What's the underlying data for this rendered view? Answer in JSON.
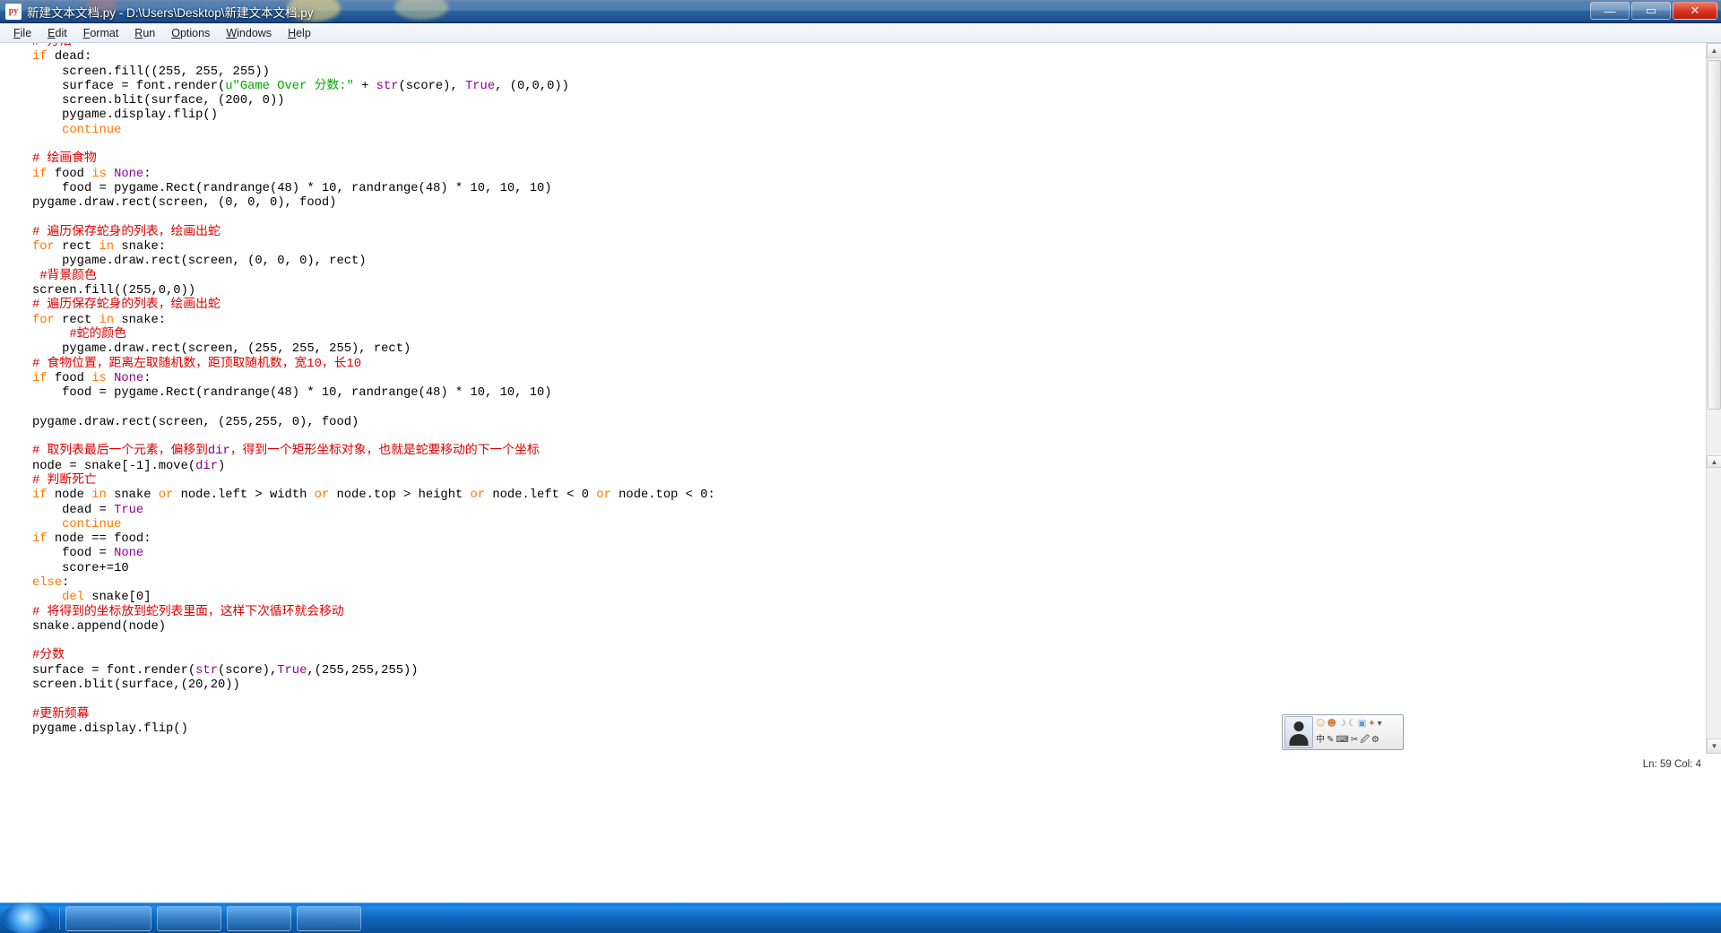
{
  "window": {
    "title": "新建文本文档.py - D:\\Users\\Desktop\\新建文本文档.py",
    "app_icon_label": "py",
    "buttons": {
      "minimize": "—",
      "maximize": "▭",
      "close": "✕"
    }
  },
  "menubar": {
    "items": [
      {
        "label": "File"
      },
      {
        "label": "Edit"
      },
      {
        "label": "Format"
      },
      {
        "label": "Run"
      },
      {
        "label": "Options"
      },
      {
        "label": "Windows"
      },
      {
        "label": "Help"
      }
    ]
  },
  "colors": {
    "comment": "#DD0000",
    "keyword": "#FF7700",
    "builtin": "#900090",
    "string": "#00AA00",
    "text": "#000000",
    "titlebar": "#1f4e8c",
    "taskbar": "#0d63b8"
  },
  "editor": {
    "language": "Python",
    "lines": [
      {
        "indent": 0,
        "tokens": [
          {
            "t": "# 方法",
            "c": "cmt"
          }
        ],
        "partial_top": true
      },
      {
        "indent": 0,
        "tokens": [
          {
            "t": "if",
            "c": "kw"
          },
          {
            "t": " dead:",
            "c": ""
          }
        ]
      },
      {
        "indent": 4,
        "tokens": [
          {
            "t": "screen.fill((255, 255, 255))",
            "c": ""
          }
        ]
      },
      {
        "indent": 4,
        "tokens": [
          {
            "t": "surface = font.render(",
            "c": ""
          },
          {
            "t": "u\"Game Over 分数:\"",
            "c": "str"
          },
          {
            "t": " + ",
            "c": ""
          },
          {
            "t": "str",
            "c": "bi"
          },
          {
            "t": "(score), ",
            "c": ""
          },
          {
            "t": "True",
            "c": "bi"
          },
          {
            "t": ", (0,0,0))",
            "c": ""
          }
        ]
      },
      {
        "indent": 4,
        "tokens": [
          {
            "t": "screen.blit(surface, (200, 0))",
            "c": ""
          }
        ]
      },
      {
        "indent": 4,
        "tokens": [
          {
            "t": "pygame.display.flip()",
            "c": ""
          }
        ]
      },
      {
        "indent": 4,
        "tokens": [
          {
            "t": "continue",
            "c": "kw"
          }
        ]
      },
      {
        "indent": 0,
        "tokens": []
      },
      {
        "indent": 0,
        "tokens": [
          {
            "t": "# 绘画食物",
            "c": "cmt"
          }
        ]
      },
      {
        "indent": 0,
        "tokens": [
          {
            "t": "if",
            "c": "kw"
          },
          {
            "t": " food ",
            "c": ""
          },
          {
            "t": "is",
            "c": "kw"
          },
          {
            "t": " ",
            "c": ""
          },
          {
            "t": "None",
            "c": "bi"
          },
          {
            "t": ":",
            "c": ""
          }
        ]
      },
      {
        "indent": 4,
        "tokens": [
          {
            "t": "food = pygame.Rect(randrange(48) * 10, randrange(48) * 10, 10, 10)",
            "c": ""
          }
        ]
      },
      {
        "indent": 0,
        "tokens": [
          {
            "t": "pygame.draw.rect(screen, (0, 0, 0), food)",
            "c": ""
          }
        ]
      },
      {
        "indent": 0,
        "tokens": []
      },
      {
        "indent": 0,
        "tokens": [
          {
            "t": "# 遍历保存蛇身的列表，绘画出蛇",
            "c": "cmt"
          }
        ]
      },
      {
        "indent": 0,
        "tokens": [
          {
            "t": "for",
            "c": "kw"
          },
          {
            "t": " rect ",
            "c": ""
          },
          {
            "t": "in",
            "c": "kw"
          },
          {
            "t": " snake:",
            "c": ""
          }
        ]
      },
      {
        "indent": 4,
        "tokens": [
          {
            "t": "pygame.draw.rect(screen, (0, 0, 0), rect)",
            "c": ""
          }
        ]
      },
      {
        "indent": 1,
        "tokens": [
          {
            "t": "#背景颜色",
            "c": "cmt"
          }
        ]
      },
      {
        "indent": 0,
        "tokens": [
          {
            "t": "screen.fill((255,0,0))",
            "c": ""
          }
        ]
      },
      {
        "indent": 0,
        "tokens": [
          {
            "t": "# 遍历保存蛇身的列表，绘画出蛇",
            "c": "cmt"
          }
        ]
      },
      {
        "indent": 0,
        "tokens": [
          {
            "t": "for",
            "c": "kw"
          },
          {
            "t": " rect ",
            "c": ""
          },
          {
            "t": "in",
            "c": "kw"
          },
          {
            "t": " snake:",
            "c": ""
          }
        ]
      },
      {
        "indent": 5,
        "tokens": [
          {
            "t": "#蛇的颜色",
            "c": "cmt"
          }
        ]
      },
      {
        "indent": 4,
        "tokens": [
          {
            "t": "pygame.draw.rect(screen, (255, 255, 255), rect)",
            "c": ""
          }
        ]
      },
      {
        "indent": 0,
        "tokens": [
          {
            "t": "# 食物位置，距离左取随机数，距顶取随机数，宽10，长10",
            "c": "cmt"
          }
        ]
      },
      {
        "indent": 0,
        "tokens": [
          {
            "t": "if",
            "c": "kw"
          },
          {
            "t": " food ",
            "c": ""
          },
          {
            "t": "is",
            "c": "kw"
          },
          {
            "t": " ",
            "c": ""
          },
          {
            "t": "None",
            "c": "bi"
          },
          {
            "t": ":",
            "c": ""
          }
        ]
      },
      {
        "indent": 4,
        "tokens": [
          {
            "t": "food = pygame.Rect(randrange(48) * 10, randrange(48) * 10, 10, 10)",
            "c": ""
          }
        ]
      },
      {
        "indent": 0,
        "tokens": []
      },
      {
        "indent": 0,
        "tokens": [
          {
            "t": "pygame.draw.rect(screen, (255,255, 0), food)",
            "c": ""
          }
        ]
      },
      {
        "indent": 0,
        "tokens": []
      },
      {
        "indent": 0,
        "tokens": [
          {
            "t": "# 取列表最后一个元素，偏移到",
            "c": "cmt"
          },
          {
            "t": "dir",
            "c": "var"
          },
          {
            "t": "，得到一个矩形坐标对象，也就是蛇要移动的下一个坐标",
            "c": "cmt"
          }
        ]
      },
      {
        "indent": 0,
        "tokens": [
          {
            "t": "node = snake[-1].move(",
            "c": ""
          },
          {
            "t": "dir",
            "c": "var"
          },
          {
            "t": ")",
            "c": ""
          }
        ]
      },
      {
        "indent": 0,
        "tokens": [
          {
            "t": "# 判断死亡",
            "c": "cmt"
          }
        ]
      },
      {
        "indent": 0,
        "tokens": [
          {
            "t": "if",
            "c": "kw"
          },
          {
            "t": " node ",
            "c": ""
          },
          {
            "t": "in",
            "c": "kw"
          },
          {
            "t": " snake ",
            "c": ""
          },
          {
            "t": "or",
            "c": "kw"
          },
          {
            "t": " node.left > width ",
            "c": ""
          },
          {
            "t": "or",
            "c": "kw"
          },
          {
            "t": " node.top > height ",
            "c": ""
          },
          {
            "t": "or",
            "c": "kw"
          },
          {
            "t": " node.left < 0 ",
            "c": ""
          },
          {
            "t": "or",
            "c": "kw"
          },
          {
            "t": " node.top < 0:",
            "c": ""
          }
        ]
      },
      {
        "indent": 4,
        "tokens": [
          {
            "t": "dead = ",
            "c": ""
          },
          {
            "t": "True",
            "c": "bi"
          }
        ]
      },
      {
        "indent": 4,
        "tokens": [
          {
            "t": "continue",
            "c": "kw"
          }
        ]
      },
      {
        "indent": 0,
        "tokens": [
          {
            "t": "if",
            "c": "kw"
          },
          {
            "t": " node == food:",
            "c": ""
          }
        ]
      },
      {
        "indent": 4,
        "tokens": [
          {
            "t": "food = ",
            "c": ""
          },
          {
            "t": "None",
            "c": "bi"
          }
        ]
      },
      {
        "indent": 4,
        "tokens": [
          {
            "t": "score+=10",
            "c": ""
          }
        ]
      },
      {
        "indent": 0,
        "tokens": [
          {
            "t": "else",
            "c": "kw"
          },
          {
            "t": ":",
            "c": ""
          }
        ]
      },
      {
        "indent": 4,
        "tokens": [
          {
            "t": "del",
            "c": "kw"
          },
          {
            "t": " snake[0]",
            "c": ""
          }
        ]
      },
      {
        "indent": 0,
        "tokens": [
          {
            "t": "# 将得到的坐标放到蛇列表里面，这样下次循环就会移动",
            "c": "cmt"
          }
        ]
      },
      {
        "indent": 0,
        "tokens": [
          {
            "t": "snake.append(node)",
            "c": ""
          }
        ]
      },
      {
        "indent": 0,
        "tokens": []
      },
      {
        "indent": 0,
        "tokens": [
          {
            "t": "#分数",
            "c": "cmt"
          }
        ]
      },
      {
        "indent": 0,
        "tokens": [
          {
            "t": "surface = font.render(",
            "c": ""
          },
          {
            "t": "str",
            "c": "bi"
          },
          {
            "t": "(score),",
            "c": ""
          },
          {
            "t": "True",
            "c": "bi"
          },
          {
            "t": ",(255,255,255))",
            "c": ""
          }
        ]
      },
      {
        "indent": 0,
        "tokens": [
          {
            "t": "screen.blit(surface,(20,20))",
            "c": ""
          }
        ]
      },
      {
        "indent": 0,
        "tokens": []
      },
      {
        "indent": 0,
        "tokens": [
          {
            "t": "#更新频幕",
            "c": "cmt"
          }
        ]
      },
      {
        "indent": 0,
        "tokens": [
          {
            "t": "pygame.display.flip()",
            "c": ""
          }
        ]
      }
    ]
  },
  "scrollbar": {
    "up_arrow": "▲",
    "down_arrow": "▼",
    "mid_handle": "▲"
  },
  "status": {
    "position": "Ln: 59 Col: 4"
  },
  "ime": {
    "language_label": "中",
    "items": [
      {
        "name": "smiley-icon",
        "glyph": "☺",
        "color": "#e8a33d"
      },
      {
        "name": "smiley-2-icon",
        "glyph": "☻",
        "color": "#d4752a"
      },
      {
        "name": "moon-icon",
        "glyph": "☽",
        "color": "#888888"
      },
      {
        "name": "moon-2-icon",
        "glyph": "☾",
        "color": "#888888"
      },
      {
        "name": "box-icon",
        "glyph": "▣",
        "color": "#6699cc"
      },
      {
        "name": "star-icon",
        "glyph": "✦",
        "color": "#cc6633"
      },
      {
        "name": "chevron-icon",
        "glyph": "▾",
        "color": "#555555"
      }
    ],
    "row2": [
      {
        "name": "chinese-mode-icon",
        "glyph": "中"
      },
      {
        "name": "pen-icon",
        "glyph": "✎"
      },
      {
        "name": "keyboard-icon",
        "glyph": "⌨"
      },
      {
        "name": "tools-icon",
        "glyph": "✂"
      },
      {
        "name": "mic-icon",
        "glyph": "🖉"
      },
      {
        "name": "settings-icon",
        "glyph": "⚙"
      }
    ]
  },
  "taskbar": {
    "start_label": "",
    "buttons": [
      {
        "name": "taskbar-item-1",
        "label": ""
      },
      {
        "name": "taskbar-item-2",
        "label": ""
      },
      {
        "name": "taskbar-item-3",
        "label": ""
      },
      {
        "name": "taskbar-item-4",
        "label": ""
      }
    ]
  }
}
